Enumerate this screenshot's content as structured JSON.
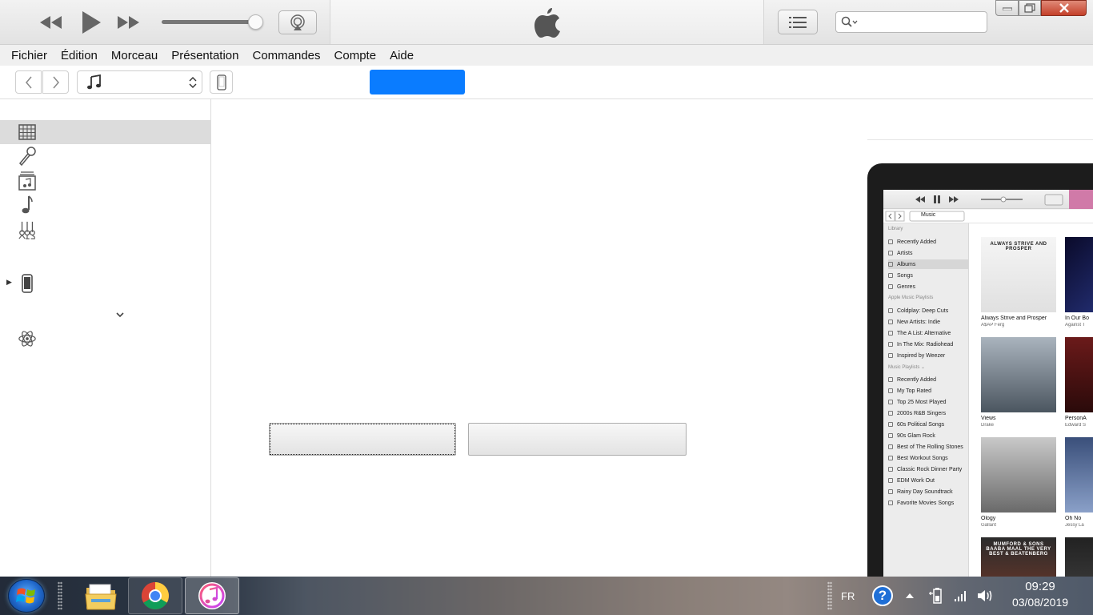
{
  "menu": [
    "Fichier",
    "Édition",
    "Morceau",
    "Présentation",
    "Commandes",
    "Compte",
    "Aide"
  ],
  "search": {
    "placeholder": ""
  },
  "nav": {
    "tab_label": ""
  },
  "main": {
    "button1_label": "",
    "button2_label": ""
  },
  "promo": {
    "media_select": "Music",
    "sidebar_heading_library": "Library",
    "library_items": [
      "Recently Added",
      "Artists",
      "Albums",
      "Songs",
      "Genres"
    ],
    "sidebar_heading_apple": "Apple Music Playlists",
    "apple_playlists": [
      "Coldplay: Deep Cuts",
      "New Artists: Indie",
      "The A List: Alternative",
      "In The Mix: Radiohead",
      "Inspired by Weezer"
    ],
    "sidebar_heading_music": "Music Playlists ⌄",
    "music_playlists": [
      "Recently Added",
      "My Top Rated",
      "Top 25 Most Played",
      "2000s R&B Singers",
      "60s Political Songs",
      "90s Glam Rock",
      "Best of The Rolling Stones",
      "Best Workout Songs",
      "Classic Rock Dinner Party",
      "EDM Work Out",
      "Rainy Day Soundtrack",
      "Favorite Movies Songs"
    ],
    "albums": [
      {
        "title": "Always Strive and Prosper",
        "artist": "A$AP Ferg",
        "art_text": "ALWAYS STRIVE AND PROSPER"
      },
      {
        "title": "In Our Bo",
        "artist": "Against T",
        "art_text": ""
      },
      {
        "title": "Views",
        "artist": "Drake",
        "art_text": ""
      },
      {
        "title": "PersonA",
        "artist": "Edward S",
        "art_text": ""
      },
      {
        "title": "Ology",
        "artist": "Gallant",
        "art_text": ""
      },
      {
        "title": "Oh No",
        "artist": "Jessy La",
        "art_text": ""
      },
      {
        "title": "",
        "artist": "",
        "art_text": "MUMFORD & SONS BAABA MAAL THE VERY BEST & BEATENBERG"
      },
      {
        "title": "",
        "artist": "",
        "art_text": "RA"
      }
    ]
  },
  "taskbar": {
    "language": "FR",
    "time": "09:29",
    "date": "03/08/2019"
  },
  "colors": {
    "accent_blue": "#0a7cff",
    "close_red": "#c4402a"
  }
}
